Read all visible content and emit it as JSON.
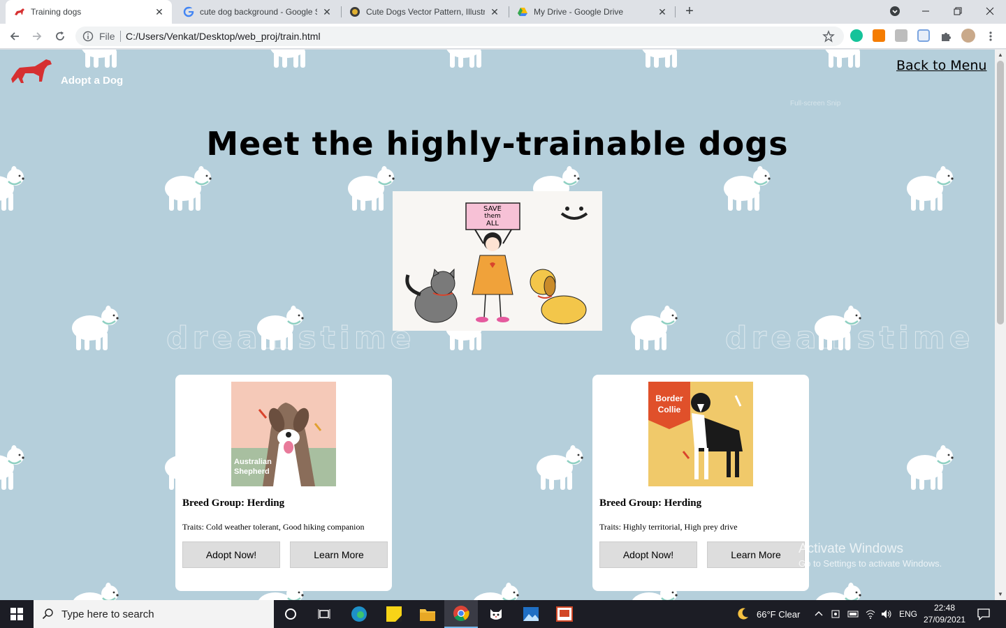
{
  "browser": {
    "tabs": [
      {
        "title": "Training dogs",
        "active": true,
        "icon": "red-dog-favicon"
      },
      {
        "title": "cute dog background - Google S",
        "active": false,
        "icon": "google-g-favicon"
      },
      {
        "title": "Cute Dogs Vector Pattern, Illustra",
        "active": false,
        "icon": "dreamstime-favicon"
      },
      {
        "title": "My Drive - Google Drive",
        "active": false,
        "icon": "google-drive-favicon"
      }
    ],
    "address": {
      "scheme_label": "File",
      "url": "C:/Users/Venkat/Desktop/web_proj/train.html"
    }
  },
  "page": {
    "logo_text": "Adopt a Dog",
    "back_link": "Back to Menu",
    "snip_ghost": "Full-screen Snip",
    "title": "Meet the highly-trainable dogs",
    "hero": {
      "sign_line1": "SAVE",
      "sign_line2": "them",
      "sign_line3": "ALL"
    },
    "watermark": "dreamstime",
    "cards": [
      {
        "photo_label_line1": "Australian",
        "photo_label_line2": "Shepherd",
        "photo_bg": "#f5c9b8",
        "group": "Breed Group: Herding",
        "traits": "Traits: Cold weather tolerant, Good hiking companion",
        "adopt_label": "Adopt Now!",
        "learn_label": "Learn More"
      },
      {
        "photo_label_line1": "Border",
        "photo_label_line2": "Collie",
        "photo_bg": "#f0c96a",
        "group": "Breed Group: Herding",
        "traits": "Traits: Highly territorial, High prey drive",
        "adopt_label": "Adopt Now!",
        "learn_label": "Learn More"
      }
    ]
  },
  "os": {
    "activate_title": "Activate Windows",
    "activate_sub": "Go to Settings to activate Windows.",
    "search_placeholder": "Type here to search",
    "weather": "66°F  Clear",
    "lang": "ENG",
    "time": "22:48",
    "date": "27/09/2021"
  },
  "colors": {
    "page_bg": "#b5cfdb",
    "logo_red": "#d63031"
  }
}
